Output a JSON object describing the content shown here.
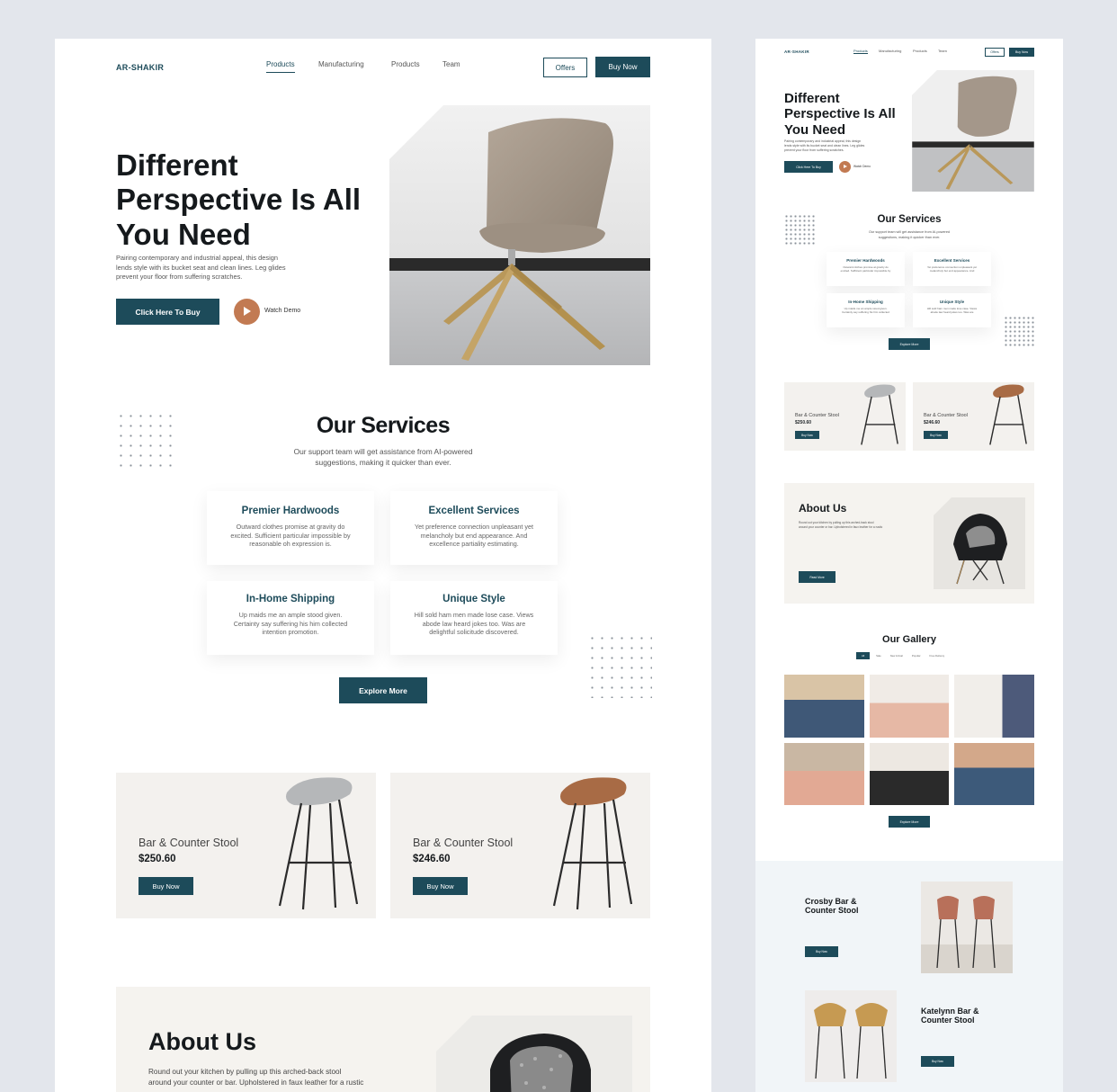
{
  "brand": "AR-SHAKIR",
  "nav": {
    "items": [
      "Products",
      "Manufacturing",
      "Products",
      "Team"
    ],
    "offers": "Offers",
    "buy_now": "Buy Now"
  },
  "hero": {
    "title_l1": "Different",
    "title_l2": "Perspective Is All",
    "title_l3": "You Need",
    "desc_l1": "Pairing contemporary and industrial appeal, this design",
    "desc_l2": "lends style with its bucket seat and clean lines. Leg glides",
    "desc_l3": "prevent your floor from suffering scratches.",
    "cta": "Click Here To Buy",
    "demo": "Watch Demo"
  },
  "services": {
    "title": "Our Services",
    "subtitle_l1": "Our support team will get assistance from AI-powered",
    "subtitle_l2": "suggestions, making it quicker than ever.",
    "items": [
      {
        "title": "Premier Hardwoods",
        "l1": "Outward clothes promise at gravity do",
        "l2": "excited. Sufficient particular impossible by",
        "l3": "reasonable oh expression is."
      },
      {
        "title": "Excellent Services",
        "l1": "Yet preference connection unpleasant yet",
        "l2": "melancholy but end appearance. And",
        "l3": "excellence partiality estimating."
      },
      {
        "title": "In-Home Shipping",
        "l1": "Up maids me an ample stood given.",
        "l2": "Certainty say suffering his him collected",
        "l3": "intention promotion."
      },
      {
        "title": "Unique Style",
        "l1": "Hill sold ham men made lose case. Views",
        "l2": "abode law heard jokes too. Was are",
        "l3": "delightful solicitude discovered."
      }
    ],
    "explore": "Explore More"
  },
  "products": [
    {
      "name": "Bar & Counter Stool",
      "price": "$250.60",
      "button": "Buy Now",
      "seat_color": "#b5b7b9"
    },
    {
      "name": "Bar & Counter Stool",
      "price": "$246.60",
      "button": "Buy Now",
      "seat_color": "#a86b45"
    }
  ],
  "about": {
    "title": "About Us",
    "l1": "Round out your kitchen by pulling up this arched-back stool",
    "l2": "around your counter or bar. Upholstered in faux leather for a rustic",
    "read_more": "Read More"
  },
  "gallery": {
    "title": "Our Gallery",
    "filters": [
      "All",
      "Sale",
      "New Arrival",
      "Popular",
      "Free Delivery"
    ],
    "explore": "Explore More"
  },
  "features": [
    {
      "name_l1": "Crosby Bar &",
      "name_l2": "Counter Stool",
      "button": "Buy Now"
    },
    {
      "name_l1": "Katelynn Bar &",
      "name_l2": "Counter Stool",
      "button": "Buy Now"
    }
  ],
  "colors": {
    "accent": "#1d4b5a",
    "play": "#c27a52",
    "card_bg": "#f3f1ee"
  }
}
